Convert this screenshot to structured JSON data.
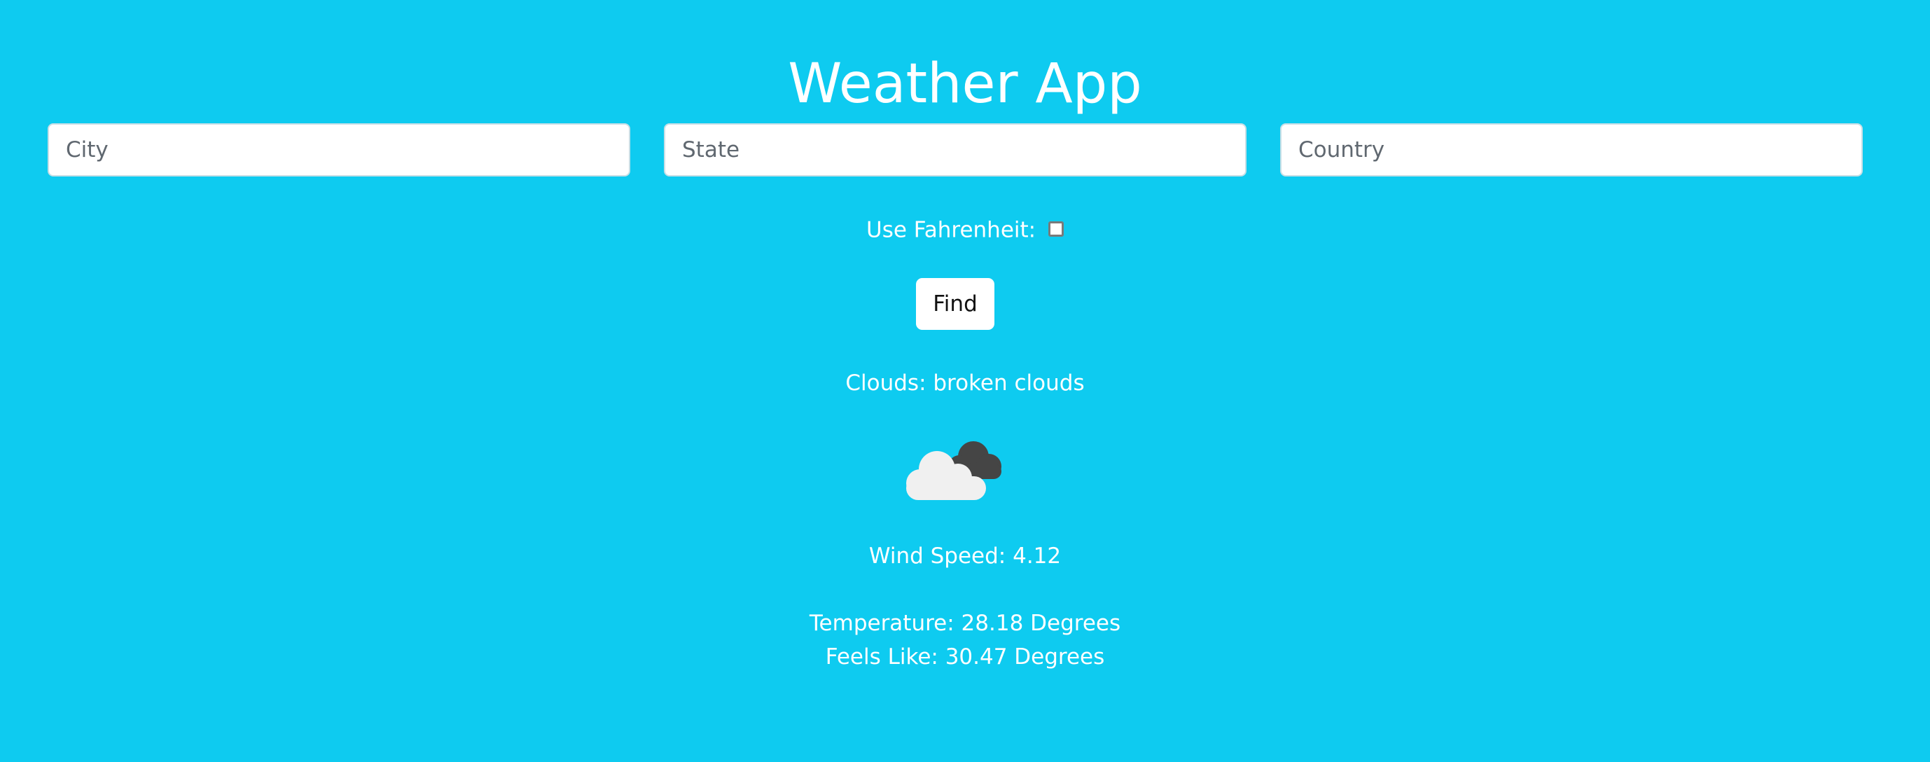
{
  "app": {
    "title": "Weather App",
    "background_color": "#0ecbf0"
  },
  "inputs": {
    "city": {
      "placeholder": "City",
      "value": ""
    },
    "state": {
      "placeholder": "State",
      "value": ""
    },
    "country": {
      "placeholder": "Country",
      "value": ""
    }
  },
  "units": {
    "label": "Use Fahrenheit:",
    "checked": false
  },
  "find_button": {
    "label": "Find"
  },
  "result": {
    "clouds": "Clouds: broken clouds",
    "icon": "broken-clouds-icon",
    "wind_speed": "Wind Speed: 4.12",
    "temperature": "Temperature: 28.18 Degrees",
    "feels_like": "Feels Like: 30.47 Degrees"
  }
}
